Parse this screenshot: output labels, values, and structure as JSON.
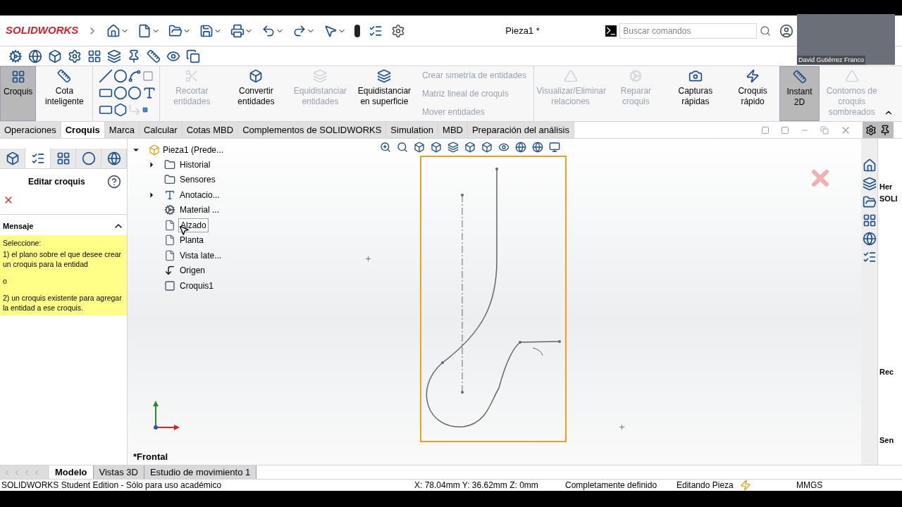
{
  "app": {
    "logo": "SOLIDWORKS",
    "document_title": "Pieza1 *",
    "search": {
      "placeholder": "Buscar comandos"
    }
  },
  "webcam": {
    "name": "David Gutiérrez Franco"
  },
  "ribbon": [
    {
      "kind": "big",
      "label": "Croquis",
      "selected": true,
      "disabled": false
    },
    {
      "kind": "big",
      "label": "Cota inteligente",
      "selected": false,
      "disabled": false
    },
    {
      "kind": "tools"
    },
    {
      "kind": "big",
      "label": "Recortar entidades",
      "selected": false,
      "disabled": true
    },
    {
      "kind": "big",
      "label": "Convertir entidades",
      "selected": false,
      "disabled": false
    },
    {
      "kind": "big",
      "label": "Equidistanciar entidades",
      "selected": false,
      "disabled": true
    },
    {
      "kind": "big",
      "label": "Equidistanciar en superficie",
      "selected": false,
      "disabled": false
    },
    {
      "kind": "list",
      "items": [
        {
          "label": "Crear simetría de entidades",
          "disabled": true
        },
        {
          "label": "Matriz lineal de croquis",
          "disabled": true
        },
        {
          "label": "Mover entidades",
          "disabled": true
        }
      ]
    },
    {
      "kind": "big",
      "label": "Visualizar/Eliminar relaciones",
      "selected": false,
      "disabled": true
    },
    {
      "kind": "big",
      "label": "Reparar croquis",
      "selected": false,
      "disabled": true
    },
    {
      "kind": "big",
      "label": "Capturas rápidas",
      "selected": false,
      "disabled": false
    },
    {
      "kind": "big",
      "label": "Croquis rápido",
      "selected": false,
      "disabled": false
    },
    {
      "kind": "big",
      "label": "Instant 2D",
      "selected": true,
      "disabled": false
    },
    {
      "kind": "big",
      "label": "Contornos de croquis sombreados",
      "selected": false,
      "disabled": true
    }
  ],
  "tabs": [
    {
      "label": "Operaciones",
      "selected": false
    },
    {
      "label": "Croquis",
      "selected": true
    },
    {
      "label": "Marca",
      "selected": false
    },
    {
      "label": "Calcular",
      "selected": false
    },
    {
      "label": "Cotas MBD",
      "selected": false
    },
    {
      "label": "Complementos de SOLIDWORKS",
      "selected": false
    },
    {
      "label": "Simulation",
      "selected": false
    },
    {
      "label": "MBD",
      "selected": false
    },
    {
      "label": "Preparación del análisis",
      "selected": false
    }
  ],
  "property_manager": {
    "tabs": [
      {
        "selected": false
      },
      {
        "selected": true
      },
      {
        "selected": false
      },
      {
        "selected": false
      },
      {
        "selected": false
      }
    ],
    "title": "Editar croquis",
    "message_heading": "Mensaje",
    "message": [
      "Seleccione:",
      "1) el plano sobre el que desee crear un croquis para la entidad",
      "o",
      "2) un croquis existente para agregar la entidad a ese croquis."
    ]
  },
  "tree": {
    "label": "Pieza1  (Prede...",
    "expanded": true,
    "children": [
      {
        "label": "Historial",
        "kind": "folder",
        "expanded": false
      },
      {
        "label": "Sensores",
        "kind": "folder"
      },
      {
        "label": "Anotacio...",
        "kind": "annotation",
        "expanded": false
      },
      {
        "label": "Material ...",
        "kind": "material"
      },
      {
        "label": "Alzado",
        "kind": "plane",
        "selected": true
      },
      {
        "label": "Planta",
        "kind": "plane",
        "selected": false
      },
      {
        "label": "Vista late...",
        "kind": "plane",
        "selected": false
      },
      {
        "label": "Origen",
        "kind": "origin"
      },
      {
        "label": "Croquis1",
        "kind": "sketch"
      }
    ]
  },
  "task_pane": {
    "headings": [
      "Her",
      "SOLI",
      "Rec",
      "Sen"
    ]
  },
  "view_label": "*Frontal",
  "bottom_tabs": [
    {
      "label": "Modelo",
      "selected": true
    },
    {
      "label": "Vistas 3D",
      "selected": false
    },
    {
      "label": "Estudio de movimiento 1",
      "selected": false
    }
  ],
  "status_bar": {
    "edition": "SOLIDWORKS Student Edition - Sólo para uso académico",
    "coordinates": "X: 78.04mm Y: 36.62mm Z: 0mm",
    "state": "Completamente definido",
    "mode": "Editando Pieza",
    "units": "MMGS"
  }
}
